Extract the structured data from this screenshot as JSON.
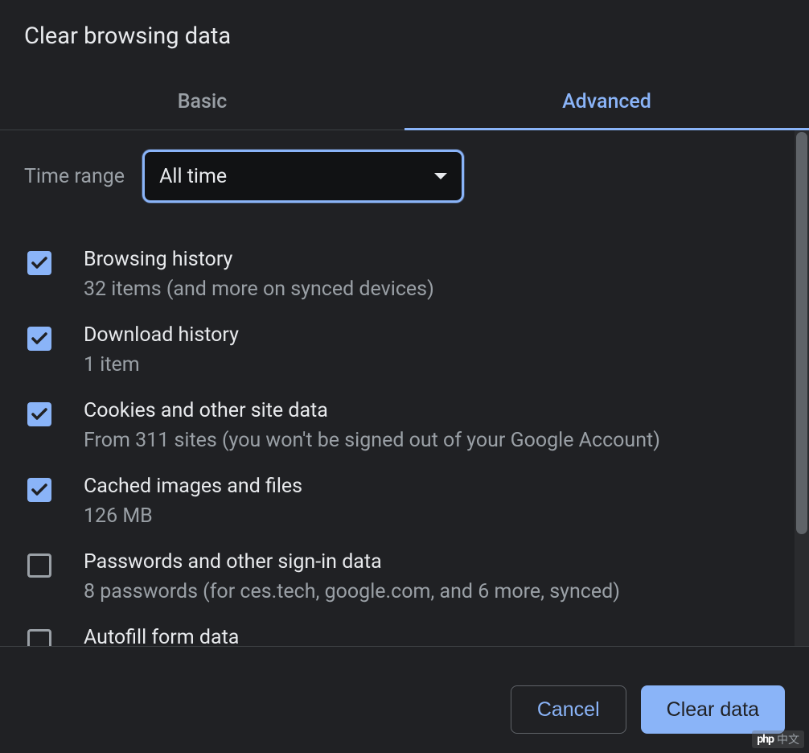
{
  "dialog": {
    "title": "Clear browsing data"
  },
  "tabs": {
    "basic": "Basic",
    "advanced": "Advanced"
  },
  "time_range": {
    "label": "Time range",
    "value": "All time"
  },
  "options": [
    {
      "title": "Browsing history",
      "subtitle": "32 items (and more on synced devices)",
      "checked": true
    },
    {
      "title": "Download history",
      "subtitle": "1 item",
      "checked": true
    },
    {
      "title": "Cookies and other site data",
      "subtitle": "From 311 sites (you won't be signed out of your Google Account)",
      "checked": true
    },
    {
      "title": "Cached images and files",
      "subtitle": "126 MB",
      "checked": true
    },
    {
      "title": "Passwords and other sign-in data",
      "subtitle": "8 passwords (for ces.tech, google.com, and 6 more, synced)",
      "checked": false
    },
    {
      "title": "Autofill form data",
      "subtitle": "",
      "checked": false
    }
  ],
  "footer": {
    "cancel": "Cancel",
    "clear": "Clear data"
  },
  "watermark": {
    "logo": "php",
    "text": "中文"
  }
}
